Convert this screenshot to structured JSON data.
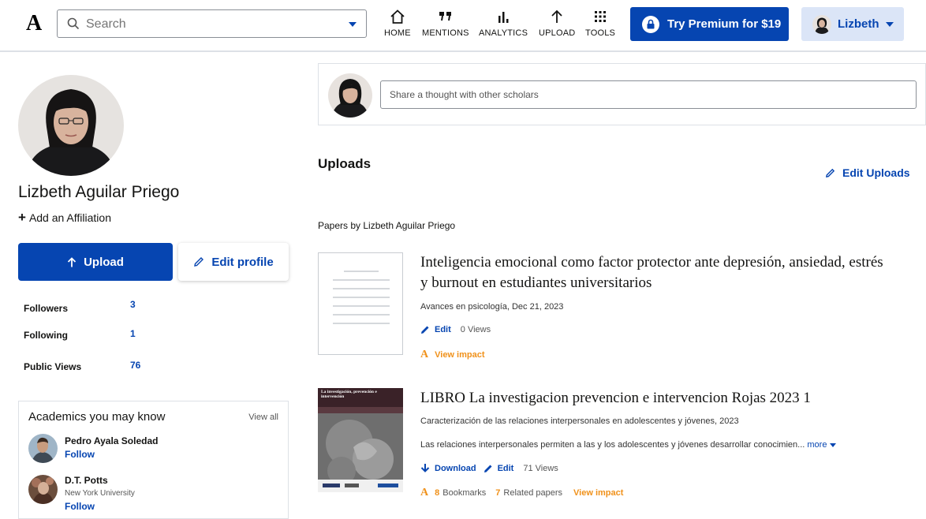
{
  "header": {
    "logo": "A",
    "search_placeholder": "Search",
    "nav": [
      {
        "label": "HOME",
        "icon": "home-icon"
      },
      {
        "label": "MENTIONS",
        "icon": "quote-icon"
      },
      {
        "label": "ANALYTICS",
        "icon": "bar-chart-icon"
      },
      {
        "label": "UPLOAD",
        "icon": "arrow-up-icon"
      },
      {
        "label": "TOOLS",
        "icon": "grid-icon"
      }
    ],
    "premium_label": "Try Premium for $19",
    "user_label": "Lizbeth"
  },
  "profile": {
    "name": "Lizbeth Aguilar Priego",
    "add_affiliation": "Add an Affiliation",
    "upload_label": "Upload",
    "edit_profile_label": "Edit profile",
    "stats": [
      {
        "label": "Followers",
        "value": "3"
      },
      {
        "label": "Following",
        "value": "1"
      },
      {
        "label": "Public Views",
        "value": "76"
      }
    ]
  },
  "academics": {
    "title": "Academics you may know",
    "view_all": "View all",
    "people": [
      {
        "name": "Pedro Ayala Soledad",
        "university": "",
        "follow": "Follow"
      },
      {
        "name": "D.T. Potts",
        "university": "New York University",
        "follow": "Follow"
      }
    ]
  },
  "share": {
    "placeholder": "Share a thought with other scholars"
  },
  "uploads": {
    "title": "Uploads",
    "edit_label": "Edit Uploads",
    "papers_by": "Papers by Lizbeth Aguilar Priego"
  },
  "papers": [
    {
      "title_line1": "Inteligencia emocional como factor protector ante depresión, ansiedad, estrés",
      "title_line2": "y burnout en estudiantes universitarios",
      "meta": "Avances en psicología, Dec 21, 2023",
      "edit": "Edit",
      "views": "0 Views",
      "impact": "View impact"
    },
    {
      "title": "LIBRO La investigacion prevencion e intervencion Rojas 2023 1",
      "meta": "Caracterización de las relaciones interpersonales en adolescentes y jóvenes, 2023",
      "abstract": "Las relaciones interpersonales permiten a las y los adolescentes y jóvenes desarrollar conocimien...",
      "more": "more",
      "download": "Download",
      "edit": "Edit",
      "views": "71 Views",
      "bookmarks_count": "8",
      "bookmarks_label": "Bookmarks",
      "related_count": "7",
      "related_label": "Related papers",
      "impact": "View impact",
      "cover_title": "La investigación, prevención e intervención"
    }
  ],
  "colors": {
    "brand": "#0645b1",
    "accent_orange": "#f0911a"
  }
}
